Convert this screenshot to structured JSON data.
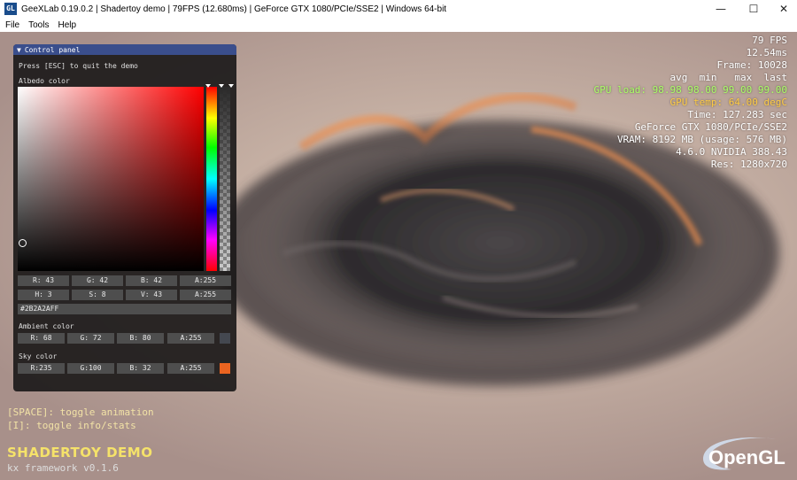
{
  "window": {
    "title": "GeeXLab 0.19.0.2 | Shadertoy demo | 79FPS (12.680ms) | GeForce GTX 1080/PCIe/SSE2 | Windows 64-bit",
    "icon_text": "GL",
    "minimize_glyph": "—",
    "maximize_glyph": "☐",
    "close_glyph": "✕"
  },
  "menu": [
    "File",
    "Tools",
    "Help"
  ],
  "control_panel": {
    "title": "Control panel",
    "collapse_glyph": "▼",
    "esc_hint": "Press [ESC] to quit the demo",
    "albedo": {
      "label": "Albedo color",
      "r": "R: 43",
      "g": "G: 42",
      "b": "B: 42",
      "a": "A:255",
      "h": "H:  3",
      "s": "S:  8",
      "v": "V: 43",
      "a2": "A:255",
      "hex": "#2B2A2AFF"
    },
    "ambient": {
      "label": "Ambient color",
      "r": "R: 68",
      "g": "G: 72",
      "b": "B: 80",
      "a": "A:255",
      "swatch": "#444850"
    },
    "sky": {
      "label": "Sky color",
      "r": "R:235",
      "g": "G:100",
      "b": "B: 32",
      "a": "A:255",
      "swatch": "#eb6420"
    }
  },
  "stats": {
    "fps": "79 FPS",
    "ms": "12.54ms",
    "frame": "Frame: 10028",
    "load_header": "avg  min   max  last",
    "gpu_load": "GPU load: 98.98 98.00 99.00 99.00",
    "gpu_temp": "GPU temp: 64.00 degC",
    "time": "Time: 127.283 sec",
    "gpu_name": "GeForce GTX 1080/PCIe/SSE2",
    "vram": "VRAM: 8192 MB (usage: 576 MB)",
    "driver": "4.6.0 NVIDIA 388.43",
    "res": "Res: 1280x720",
    "load_color": "#aaff66",
    "temp_color": "#ffcc44"
  },
  "hints": {
    "space": "[SPACE]: toggle animation",
    "info": "[I]: toggle info/stats"
  },
  "demo": {
    "title": "SHADERTOY DEMO",
    "framework": "kx framework v0.1.6"
  },
  "logo": {
    "text": "OpenGL"
  }
}
